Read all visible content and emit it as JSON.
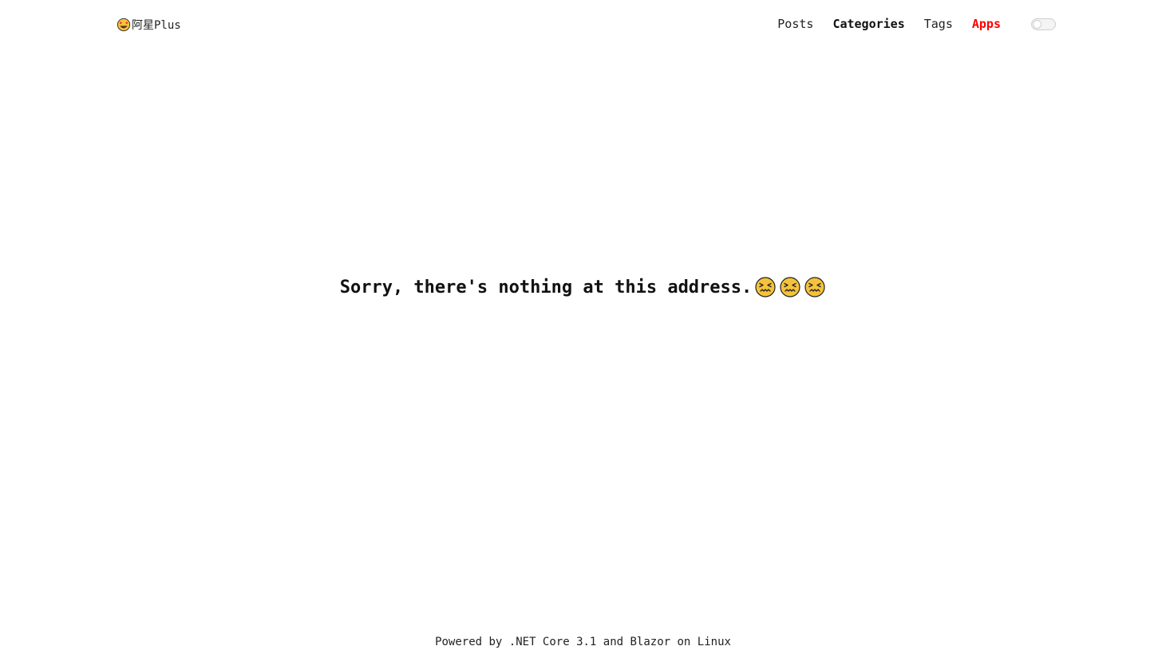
{
  "header": {
    "site_name": "阿星Plus",
    "logo_icon": "star-struck-face-icon",
    "nav": [
      {
        "label": "Posts"
      },
      {
        "label": "Categories"
      },
      {
        "label": "Tags"
      },
      {
        "label": "Apps"
      }
    ],
    "theme_toggle": {
      "icon": "theme-toggle-switch",
      "state": "off"
    }
  },
  "main": {
    "message": "Sorry, there's nothing at this address.",
    "emoji_icons": [
      "confounded-face-icon",
      "confounded-face-icon",
      "confounded-face-icon"
    ]
  },
  "footer": {
    "text": "Powered by .NET Core 3.1 and Blazor on Linux"
  },
  "colors": {
    "accent": "#ff0000",
    "text": "#1a1a1a",
    "emoji_yellow": "#f5c33b"
  }
}
